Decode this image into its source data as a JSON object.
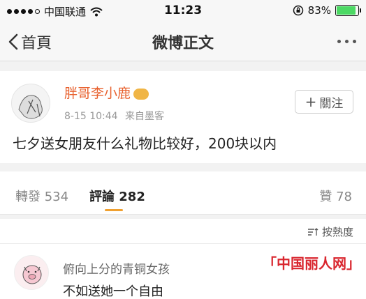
{
  "status_bar": {
    "carrier": "中国联通",
    "time": "11:23",
    "battery_percent_text": "83%",
    "battery_level": 0.83,
    "signal_bars": 4
  },
  "nav": {
    "back_label": "首頁",
    "title": "微博正文"
  },
  "post": {
    "username": "胖哥李小鹿",
    "timestamp": "8-15 10:44",
    "source": "来自墨客",
    "follow_label": "關注",
    "content": "七夕送女朋友什么礼物比较好，200块以内"
  },
  "actions": {
    "repost_label": "轉發",
    "repost_count": "534",
    "comment_label": "評論",
    "comment_count": "282",
    "like_label": "贊",
    "like_count": "78"
  },
  "sort": {
    "label": "按熱度"
  },
  "comment": {
    "username": "俯向上分的青铜女孩",
    "text": "不如送她一个自由"
  },
  "watermark": {
    "text": "「中国丽人网」"
  },
  "colors": {
    "username": "#e8612e",
    "accent_underline": "#f0a030",
    "watermark": "#d9262e",
    "battery": "#4cd964"
  }
}
